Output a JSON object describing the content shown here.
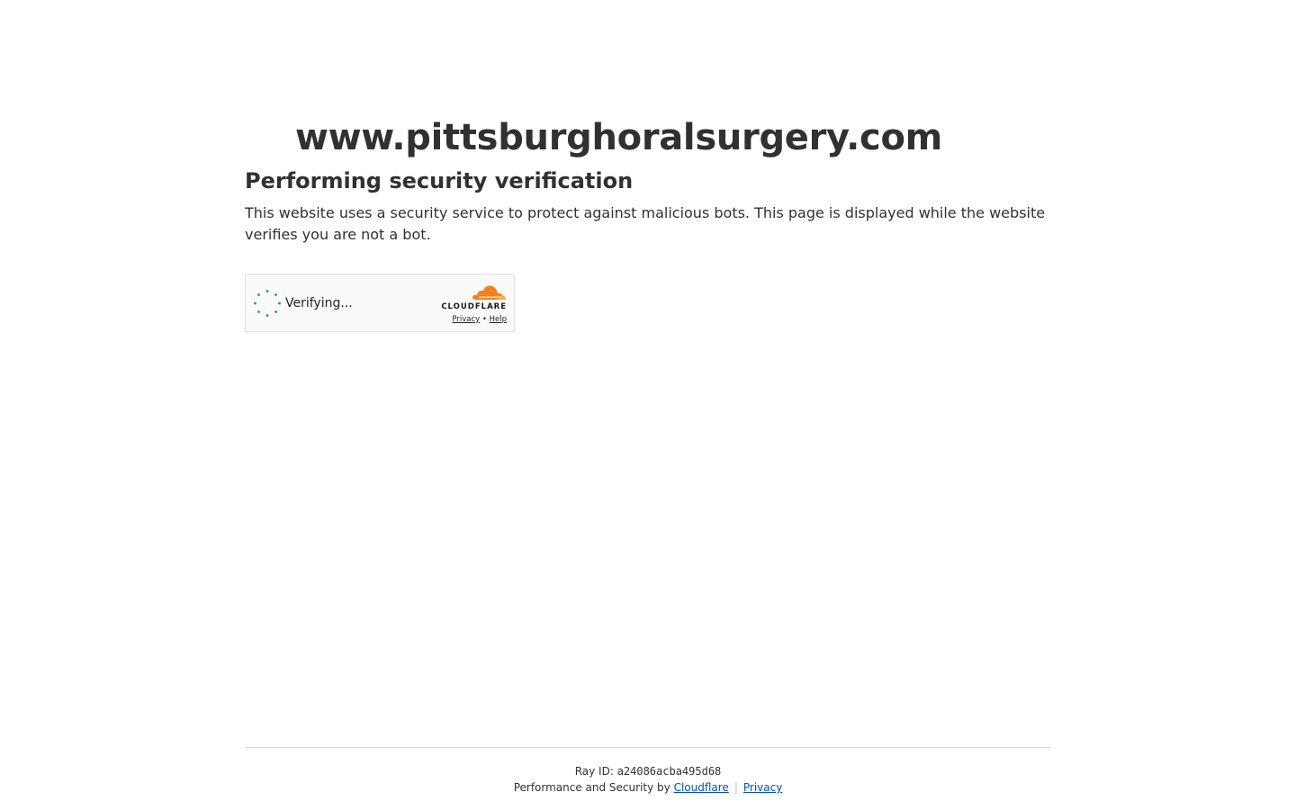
{
  "site": {
    "domain": "www.pittsburghoralsurgery.com"
  },
  "verification": {
    "heading": "Performing security verification",
    "description": "This website uses a security service to protect against malicious bots. This page is displayed while the website verifies you are not a bot."
  },
  "widget": {
    "status_text": "Verifying...",
    "brand": "CLOUDFLARE",
    "privacy_link": "Privacy",
    "link_separator": "•",
    "help_link": "Help",
    "spinner_color": "#1a9e6a",
    "cloud_colors": [
      "#f48120",
      "#faad3f"
    ]
  },
  "footer": {
    "ray_label": "Ray ID: ",
    "ray_id": "a24086acba495d68",
    "perf_text": "Performance and Security by ",
    "cloudflare_link": "Cloudflare",
    "separator": "|",
    "privacy_link": "Privacy",
    "link_color": "#0051c3"
  }
}
